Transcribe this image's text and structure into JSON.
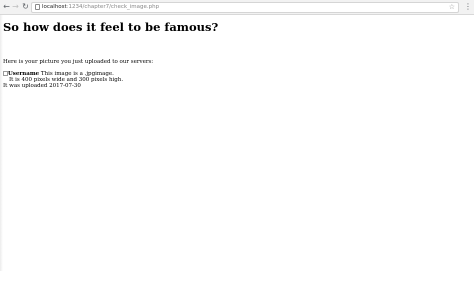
{
  "browser": {
    "url_host": "localhost",
    "url_path": ":1234/chapter7/check_image.php",
    "icons": {
      "back": "arrow-left-icon",
      "forward": "arrow-right-icon",
      "reload": "reload-icon",
      "bookmark": "star-icon",
      "menu": "more-vert-icon"
    }
  },
  "page": {
    "heading": "So how does it feel to be famous?",
    "intro": "Here is your picture you just uploaded to our servers:",
    "image_alt": "Username",
    "image_type_text": "This image is a .jpgimage.",
    "image_size_text": "It is 400 pixels wide and 300 pixels high.",
    "upload_text": "It was uploaded 2017-07-30"
  }
}
